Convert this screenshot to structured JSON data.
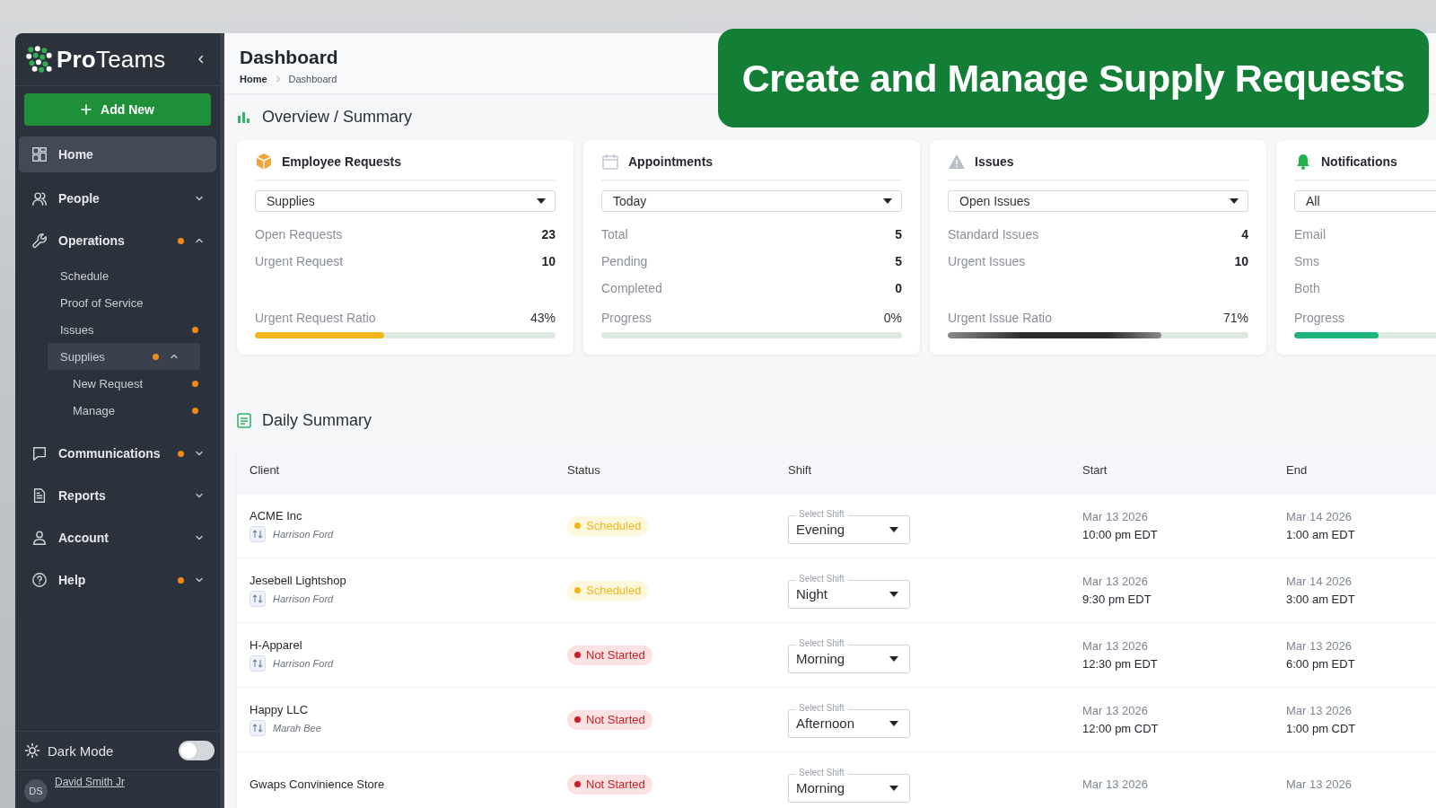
{
  "banner": {
    "text": "Create and Manage Supply Requests"
  },
  "sidebar": {
    "logo": "**Pro**Teams",
    "add_button": "Add New",
    "items": [
      {
        "label": "Home",
        "selected": true
      },
      {
        "label": "People",
        "selected": false,
        "dot": false,
        "expanded": false
      },
      {
        "label": "Operations",
        "selected": false,
        "dot": true,
        "expanded": true,
        "children": [
          {
            "label": "Schedule",
            "selected": false,
            "dot": false
          },
          {
            "label": "Proof of Service",
            "selected": false,
            "dot": false
          },
          {
            "label": "Issues",
            "selected": false,
            "dot": true
          },
          {
            "label": "Supplies",
            "selected": true,
            "dot": true,
            "expanded": true,
            "children": [
              {
                "label": "New Request",
                "selected": false,
                "dot": true
              },
              {
                "label": "Manage",
                "selected": false,
                "dot": true
              }
            ]
          }
        ]
      },
      {
        "label": "Communications",
        "selected": false,
        "dot": true,
        "expanded": false
      },
      {
        "label": "Reports",
        "selected": false,
        "dot": false,
        "expanded": false
      },
      {
        "label": "Account",
        "selected": false,
        "dot": false,
        "expanded": false
      },
      {
        "label": "Help",
        "selected": false,
        "dot": true,
        "expanded": false
      }
    ],
    "dark_mode": {
      "label": "Dark Mode",
      "on": false
    },
    "user": {
      "initials": "DS",
      "name": "David Smith Jr"
    }
  },
  "header": {
    "title": "Dashboard",
    "breadcrumb": [
      "Home",
      "Dashboard"
    ]
  },
  "overview": {
    "title": "Overview / Summary",
    "cards": [
      {
        "title": "Employee Requests",
        "filter": "Supplies",
        "stats": [
          {
            "label": "Open Requests",
            "value": "23"
          },
          {
            "label": "Urgent Request",
            "value": "10"
          }
        ],
        "ratio": {
          "label": "Urgent Request Ratio",
          "value": "43%",
          "level": 0.43,
          "color": "#f2b51c"
        }
      },
      {
        "title": "Appointments",
        "filter": "Today",
        "stats": [
          {
            "label": "Total",
            "value": "5"
          },
          {
            "label": "Pending",
            "value": "5"
          },
          {
            "label": "Completed",
            "value": "0"
          }
        ],
        "ratio": {
          "label": "Progress",
          "value": "0%",
          "level": 0
        }
      },
      {
        "title": "Issues",
        "filter": "Open Issues",
        "stats": [
          {
            "label": "Standard Issues",
            "value": "4"
          },
          {
            "label": "Urgent Issues",
            "value": "10"
          }
        ],
        "ratio": {
          "label": "Urgent Issue Ratio",
          "value": "71%",
          "level": 0.71,
          "color": "#2b2b2b"
        }
      },
      {
        "title": "Notifications",
        "filter": "All",
        "stats": [
          {
            "label": "Email"
          },
          {
            "label": "Sms"
          },
          {
            "label": "Both"
          }
        ],
        "ratio": {
          "label": "Progress",
          "level": 0.28,
          "color": "#1fb57a"
        }
      }
    ]
  },
  "daily_summary": {
    "title": "Daily Summary",
    "columns": [
      "Client",
      "Status",
      "Shift",
      "Start",
      "End"
    ],
    "rows": [
      {
        "client": "ACME Inc",
        "contact": "Harrison Ford",
        "status": {
          "label": "Scheduled",
          "kind": "scheduled"
        },
        "shift": {
          "placeholder": "Select Shift",
          "value": "Evening"
        },
        "start_date": "Mar 13 2026",
        "start_time": "10:00 pm EDT",
        "end_date": "Mar 14 2026",
        "end_time": "1:00 am EDT"
      },
      {
        "client": "Jesebell Lightshop",
        "contact": "Harrison Ford",
        "status": {
          "label": "Scheduled",
          "kind": "scheduled"
        },
        "shift": {
          "placeholder": "Select Shift",
          "value": "Night"
        },
        "start_date": "Mar 13 2026",
        "start_time": "9:30 pm EDT",
        "end_date": "Mar 14 2026",
        "end_time": "3:00 am EDT"
      },
      {
        "client": "H-Apparel",
        "contact": "Harrison Ford",
        "status": {
          "label": "Not Started",
          "kind": "not_started"
        },
        "shift": {
          "placeholder": "Select Shift",
          "value": "Morning"
        },
        "start_date": "Mar 13 2026",
        "start_time": "12:30 pm EDT",
        "end_date": "Mar 13 2026",
        "end_time": "6:00 pm EDT"
      },
      {
        "client": "Happy LLC",
        "contact": "Marah Bee",
        "status": {
          "label": "Not Started",
          "kind": "not_started"
        },
        "shift": {
          "placeholder": "Select Shift",
          "value": "Afternoon"
        },
        "start_date": "Mar 13 2026",
        "start_time": "12:00 pm CDT",
        "end_date": "Mar 13 2026",
        "end_time": "1:00 pm CDT"
      },
      {
        "client": "Gwaps Convinience Store",
        "status": {
          "label": "Not Started",
          "kind": "not_started"
        },
        "shift": {
          "placeholder": "Select Shift",
          "value": "Morning"
        },
        "start_date": "Mar 13 2026",
        "end_date": "Mar 13 2026"
      }
    ]
  }
}
